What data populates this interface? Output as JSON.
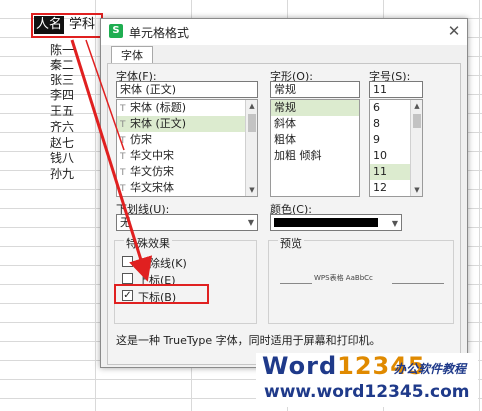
{
  "sheet": {
    "a1": "人名",
    "b1": "学科",
    "names": [
      "陈一",
      "秦二",
      "张三",
      "李四",
      "王五",
      "齐六",
      "赵七",
      "钱八",
      "孙九"
    ]
  },
  "dialog": {
    "title": "单元格格式",
    "tab": "字体",
    "font_label": "字体(F):",
    "font_value": "宋体 (正文)",
    "font_list": [
      "宋体 (标题)",
      "宋体 (正文)",
      "仿宋",
      "华文中宋",
      "华文仿宋",
      "华文宋体"
    ],
    "style_label": "字形(O):",
    "style_value": "常规",
    "style_list": [
      "常规",
      "斜体",
      "粗体",
      "加粗 倾斜"
    ],
    "size_label": "字号(S):",
    "size_value": "11",
    "size_list": [
      "6",
      "8",
      "9",
      "10",
      "11",
      "12"
    ],
    "underline_label": "下划线(U):",
    "underline_value": "无",
    "color_label": "颜色(C):",
    "effects_label": "特殊效果",
    "strike_label": "删除线(K)",
    "super_label": "上标(E)",
    "sub_label": "下标(B)",
    "preview_label": "预览",
    "preview_text": "WPS表格  AaBbCc",
    "footer": "这是一种 TrueType 字体，同时适用于屏幕和打印机。"
  },
  "watermark": {
    "word": "Word",
    "digits": "12345",
    "cn": "办公软件教程",
    "url": "www.word12345.com"
  },
  "colors": {
    "accent_red": "#e02020",
    "selection": "#dcebcf",
    "brand_green": "#1fae51"
  }
}
